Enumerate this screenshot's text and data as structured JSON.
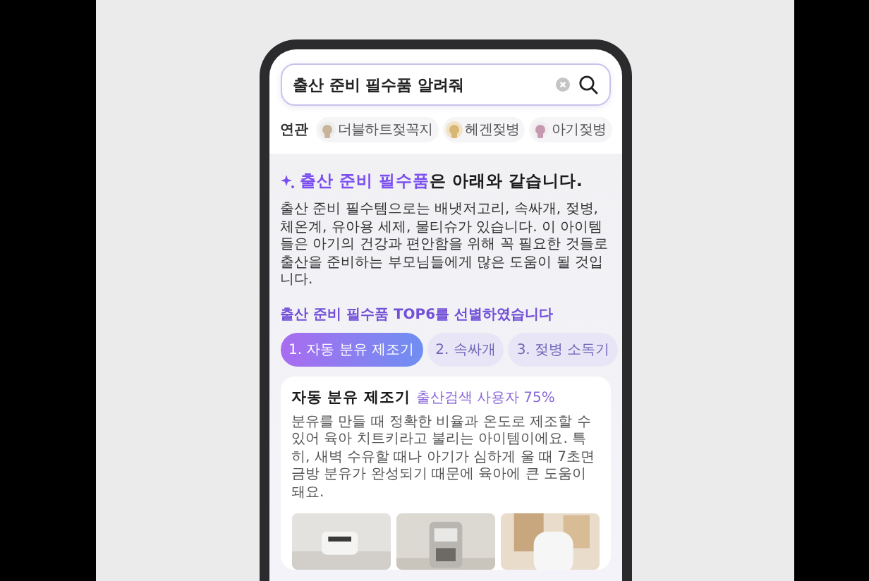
{
  "search": {
    "value": "출산 준비 필수품 알려줘"
  },
  "related": {
    "label": "연관",
    "chips": [
      {
        "label": "더블하트젖꼭지"
      },
      {
        "label": "헤겐젖병"
      },
      {
        "label": "아기젖병"
      }
    ]
  },
  "answer": {
    "heading": "**출산 준비 필수품**은 아래와 같습니다.",
    "body": "출산 준비 필수템으로는 배냇저고리, 속싸개, 젖병, 체온계, 유아용 세제, 물티슈가 있습니다. 이 아이템들은 아기의 건강과 편안함을 위해 꼭 필요한 것들로 출산을 준비하는 부모님들에게 많은 도움이 될 것입니다."
  },
  "top_picks": {
    "title": "출산 준비 필수품 TOP6를 선별하였습니다",
    "tabs": [
      {
        "label": "1. 자동 분유 제조기",
        "selected": true
      },
      {
        "label": "2. 속싸개",
        "selected": false
      },
      {
        "label": "3. 젖병 소독기",
        "selected": false
      }
    ],
    "card": {
      "title": "자동 분유 제조기",
      "tag": "출산검색 사용자 75%",
      "description": "분유를 만들 때 정확한 비율과 온도로 제조할 수 있어 육아 치트키라고 불리는 아이템이에요. 특히, 새벽 수유할 때나 아기가 심하게 울 때 7초면 금방 분유가 완성되기 때문에 육아에 큰 도움이 돼요."
    }
  }
}
